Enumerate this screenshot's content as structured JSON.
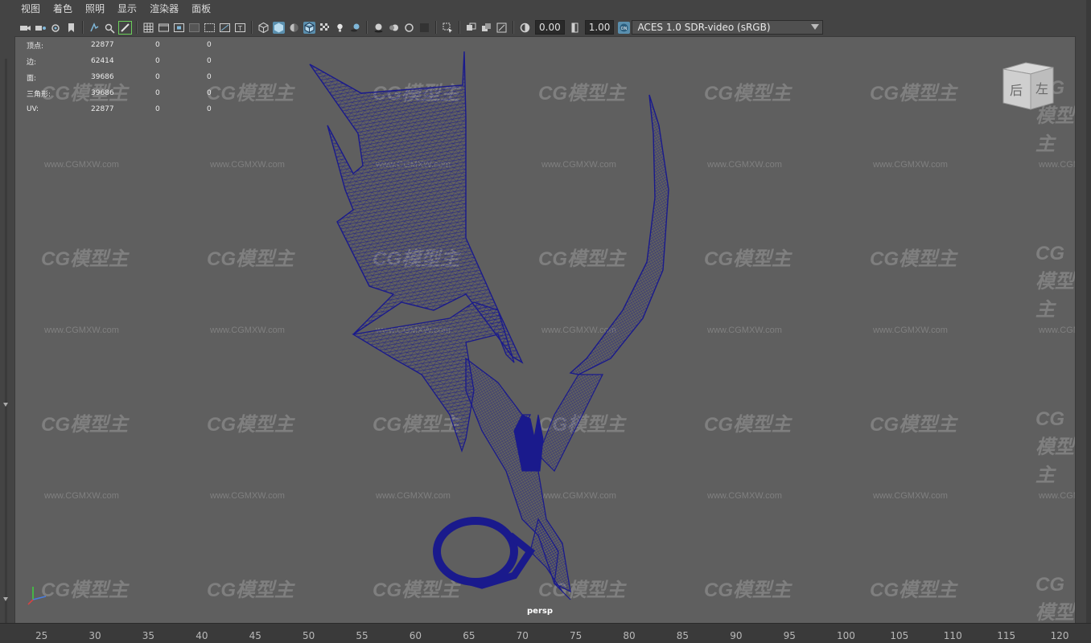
{
  "menu": [
    "视图",
    "着色",
    "照明",
    "显示",
    "渲染器",
    "面板"
  ],
  "toolbar": {
    "exposure_value": "0.00",
    "gamma_value": "1.00",
    "colorspace": "ACES 1.0 SDR-video (sRGB)"
  },
  "hud": {
    "rows": [
      {
        "label": "顶点:",
        "value": "22877",
        "a": "0",
        "b": "0"
      },
      {
        "label": "边:",
        "value": "62414",
        "a": "0",
        "b": "0"
      },
      {
        "label": "面:",
        "value": "39686",
        "a": "0",
        "b": "0"
      },
      {
        "label": "三角形:",
        "value": "39686",
        "a": "0",
        "b": "0"
      },
      {
        "label": "UV:",
        "value": "22877",
        "a": "0",
        "b": "0"
      }
    ]
  },
  "viewport": {
    "camera_label": "persp",
    "viewcube_labels": [
      "后",
      "左"
    ]
  },
  "watermark": {
    "logo_text": "CG模型主",
    "url_text": "www.CGMXW.com"
  },
  "ruler": {
    "ticks": [
      "25",
      "30",
      "35",
      "40",
      "45",
      "50",
      "55",
      "60",
      "65",
      "70",
      "75",
      "80",
      "85",
      "90",
      "95",
      "100",
      "105",
      "110",
      "115",
      "120"
    ]
  },
  "colors": {
    "wireframe": "#1a1a8c",
    "viewport_bg": "#5f5f5f",
    "ui_bg": "#444444"
  }
}
